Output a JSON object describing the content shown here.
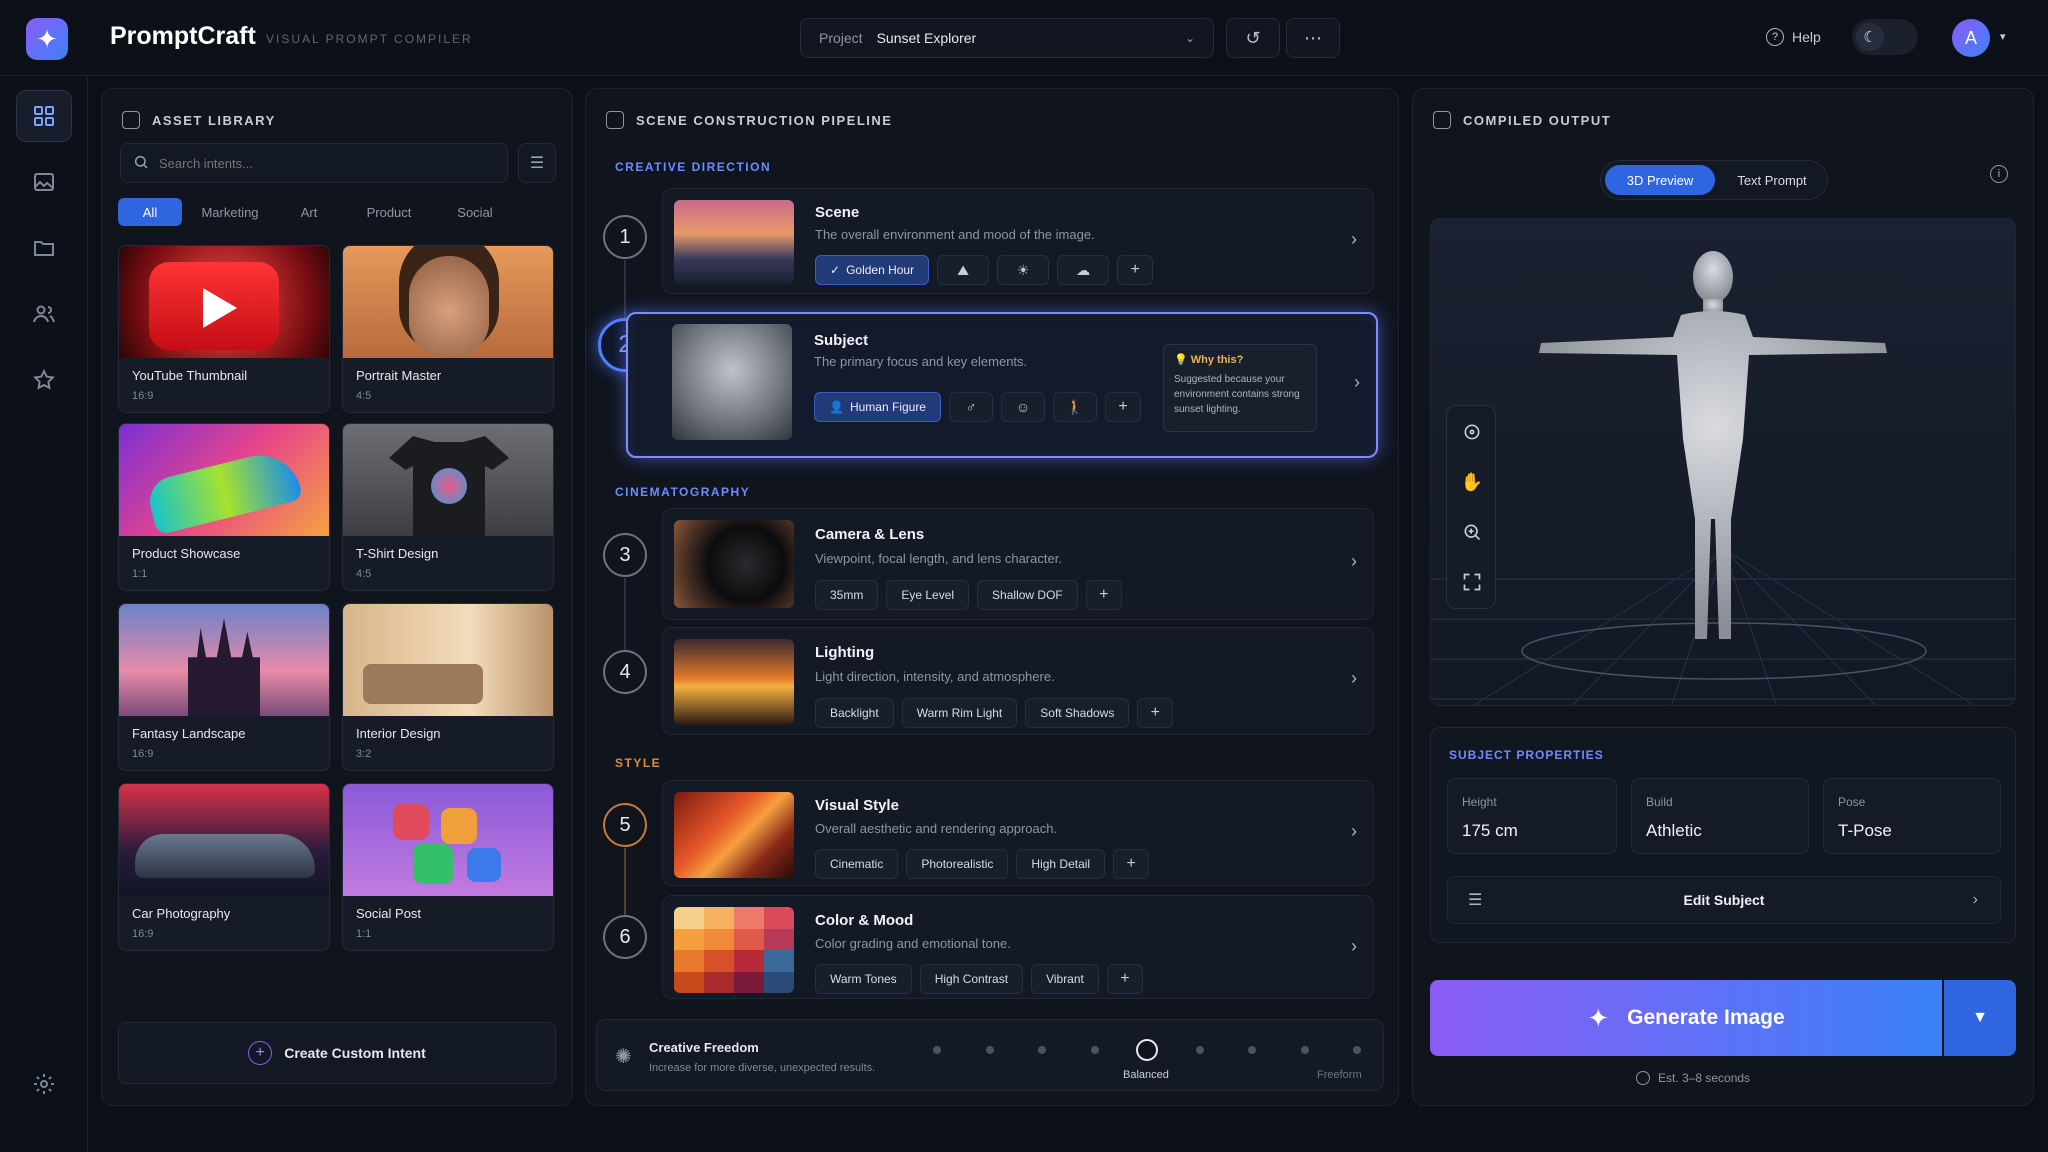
{
  "header": {
    "logo_glyph": "✦",
    "app_name": "PromptCraft",
    "app_subtitle": "VISUAL PROMPT COMPILER",
    "project_label": "Project",
    "project_value": "Sunset Explorer",
    "help_label": "Help",
    "avatar_initial": "A"
  },
  "sidebar": {
    "items": [
      "grid-icon",
      "image-icon",
      "folder-icon",
      "users-icon",
      "star-icon"
    ],
    "bottom": "settings-icon"
  },
  "asset_library": {
    "title": "ASSET LIBRARY",
    "search_placeholder": "Search intents...",
    "filters": [
      "All",
      "Marketing",
      "Art",
      "Product",
      "Social"
    ],
    "active_filter": "All",
    "cards": [
      {
        "name": "YouTube Thumbnail",
        "ratio": "16:9"
      },
      {
        "name": "Portrait Master",
        "ratio": "4:5"
      },
      {
        "name": "Product Showcase",
        "ratio": "1:1"
      },
      {
        "name": "T-Shirt Design",
        "ratio": "4:5"
      },
      {
        "name": "Fantasy Landscape",
        "ratio": "16:9"
      },
      {
        "name": "Interior Design",
        "ratio": "3:2"
      },
      {
        "name": "Car Photography",
        "ratio": "16:9"
      },
      {
        "name": "Social Post",
        "ratio": "1:1"
      }
    ],
    "create_label": "Create Custom Intent"
  },
  "pipeline": {
    "title": "SCENE CONSTRUCTION PIPELINE",
    "sections": {
      "creative": "CREATIVE DIRECTION",
      "cinematography": "CINEMATOGRAPHY",
      "style": "STYLE"
    },
    "steps": [
      {
        "num": "1",
        "title": "Scene",
        "desc": "The overall environment and mood of the image.",
        "tags": [
          "Golden Hour"
        ]
      },
      {
        "num": "2",
        "title": "Subject",
        "desc": "The primary focus and key elements.",
        "tags": [
          "Human Figure"
        ]
      },
      {
        "num": "3",
        "title": "Camera & Lens",
        "desc": "Viewpoint, focal length, and lens character.",
        "tags": [
          "35mm",
          "Eye Level",
          "Shallow DOF"
        ]
      },
      {
        "num": "4",
        "title": "Lighting",
        "desc": "Light direction, intensity, and atmosphere.",
        "tags": [
          "Backlight",
          "Warm Rim Light",
          "Soft Shadows"
        ]
      },
      {
        "num": "5",
        "title": "Visual Style",
        "desc": "Overall aesthetic and rendering approach.",
        "tags": [
          "Cinematic",
          "Photorealistic",
          "High Detail"
        ]
      },
      {
        "num": "6",
        "title": "Color & Mood",
        "desc": "Color grading and emotional tone.",
        "tags": [
          "Warm Tones",
          "High Contrast",
          "Vibrant"
        ]
      }
    ],
    "why": {
      "title": "Why this?",
      "body": "Suggested because your environment contains strong sunset lighting."
    },
    "freedom": {
      "title": "Creative Freedom",
      "desc": "Increase for more diverse, unexpected results.",
      "current": "Balanced",
      "max_label": "Freeform",
      "level": 0.5
    }
  },
  "output": {
    "title": "COMPILED OUTPUT",
    "tabs": [
      "3D Preview",
      "Text Prompt"
    ],
    "active_tab": "3D Preview",
    "subject_properties": {
      "title": "SUBJECT PROPERTIES",
      "props": [
        {
          "label": "Height",
          "value": "175 cm"
        },
        {
          "label": "Build",
          "value": "Athletic"
        },
        {
          "label": "Pose",
          "value": "T-Pose"
        }
      ],
      "edit_label": "Edit Subject"
    },
    "generate_label": "Generate Image",
    "estimate": "Est. 3–8 seconds"
  },
  "colors": {
    "accent": "#2f66e0",
    "brand_gradient_start": "#8b5cf6",
    "brand_gradient_end": "#3b82f6",
    "section_creative": "#6d8cff",
    "section_style": "#e08a3c"
  }
}
